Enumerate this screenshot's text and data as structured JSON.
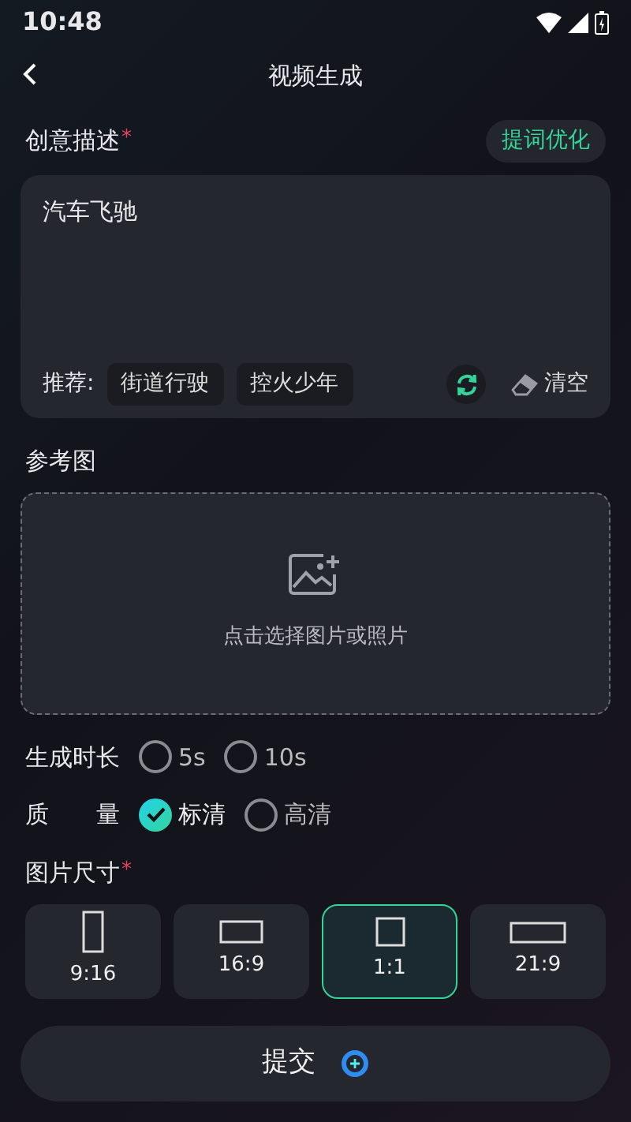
{
  "status_bar": {
    "time": "10:48"
  },
  "header": {
    "title": "视频生成"
  },
  "description": {
    "label": "创意描述",
    "required_mark": "*",
    "optimize_button": "提词优化",
    "value": "汽车飞驰",
    "recommend_label": "推荐:",
    "suggestions": [
      "街道行驶",
      "控火少年"
    ],
    "clear_button": "清空"
  },
  "reference": {
    "label": "参考图",
    "upload_text": "点击选择图片或照片"
  },
  "duration": {
    "label": "生成时长",
    "options": [
      {
        "label": "5s",
        "selected": false
      },
      {
        "label": "10s",
        "selected": false
      }
    ]
  },
  "quality": {
    "label_parts": [
      "质",
      "量"
    ],
    "options": [
      {
        "label": "标清",
        "selected": true
      },
      {
        "label": "高清",
        "selected": false
      }
    ]
  },
  "size": {
    "label": "图片尺寸",
    "required_mark": "*",
    "options": [
      {
        "label": "9:16",
        "kind": "portrait",
        "selected": false
      },
      {
        "label": "16:9",
        "kind": "landscape",
        "selected": false
      },
      {
        "label": "1:1",
        "kind": "square",
        "selected": true
      },
      {
        "label": "21:9",
        "kind": "wide",
        "selected": false
      }
    ]
  },
  "submit": {
    "label": "提交"
  }
}
